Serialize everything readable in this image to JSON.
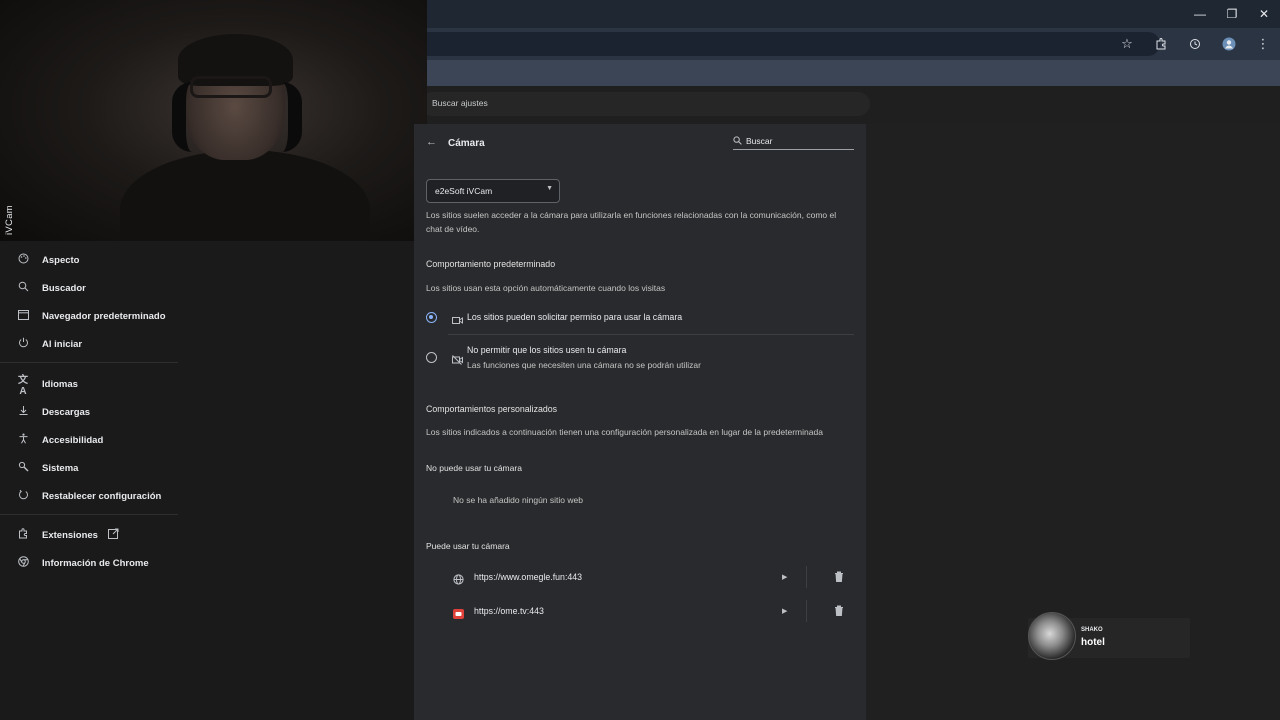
{
  "window": {
    "minimize": "—",
    "restore": "❐",
    "close": "✕"
  },
  "toolbar": {
    "icons": [
      "star-icon",
      "extensions-icon",
      "history-icon",
      "profile-icon",
      "menu-icon"
    ]
  },
  "settings_search": {
    "placeholder": "Buscar ajustes"
  },
  "webcam": {
    "label": "iVCam"
  },
  "nav": {
    "items": [
      {
        "label": "Aspecto",
        "icon": "palette-icon"
      },
      {
        "label": "Buscador",
        "icon": "search-icon"
      },
      {
        "label": "Navegador predeterminado",
        "icon": "browser-icon"
      },
      {
        "label": "Al iniciar",
        "icon": "power-icon"
      },
      {
        "label": "Idiomas",
        "icon": "translate-icon"
      },
      {
        "label": "Descargas",
        "icon": "download-icon"
      },
      {
        "label": "Accesibilidad",
        "icon": "accessibility-icon"
      },
      {
        "label": "Sistema",
        "icon": "wrench-icon"
      },
      {
        "label": "Restablecer configuración",
        "icon": "reset-icon"
      },
      {
        "label": "Extensiones",
        "icon": "puzzle-icon"
      },
      {
        "label": "Información de Chrome",
        "icon": "chrome-icon"
      }
    ]
  },
  "camera_page": {
    "title": "Cámara",
    "search_placeholder": "Buscar",
    "device_select": "e2eSoft iVCam",
    "description_line1": "Los sitios suelen acceder a la cámara para utilizarla en funciones relacionadas con la comunicación, como el",
    "description_line2": "chat de vídeo.",
    "default_behavior": {
      "heading": "Comportamiento predeterminado",
      "subheading": "Los sitios usan esta opción automáticamente cuando los visitas",
      "option_allow": "Los sitios pueden solicitar permiso para usar la cámara",
      "option_block": "No permitir que los sitios usen tu cámara",
      "option_block_sub": "Las funciones que necesiten una cámara no se podrán utilizar",
      "selected": "allow"
    },
    "custom_behavior": {
      "heading": "Comportamientos personalizados",
      "subheading": "Los sitios indicados a continuación tienen una configuración personalizada en lugar de la predeterminada",
      "blocked_heading": "No puede usar tu cámara",
      "blocked_empty": "No se ha añadido ningún sitio web",
      "allowed_heading": "Puede usar tu cámara",
      "allowed_sites": [
        {
          "url": "https://www.omegle.fun:443",
          "icon": "globe-icon"
        },
        {
          "url": "https://ome.tv:443",
          "icon": "ometv-favicon-icon"
        }
      ]
    }
  },
  "notification": {
    "small": "SHAKO",
    "big": "hotel"
  },
  "colors": {
    "accent": "#8ab4f8",
    "panel": "#292a2d",
    "nav": "#1a1a1a"
  }
}
